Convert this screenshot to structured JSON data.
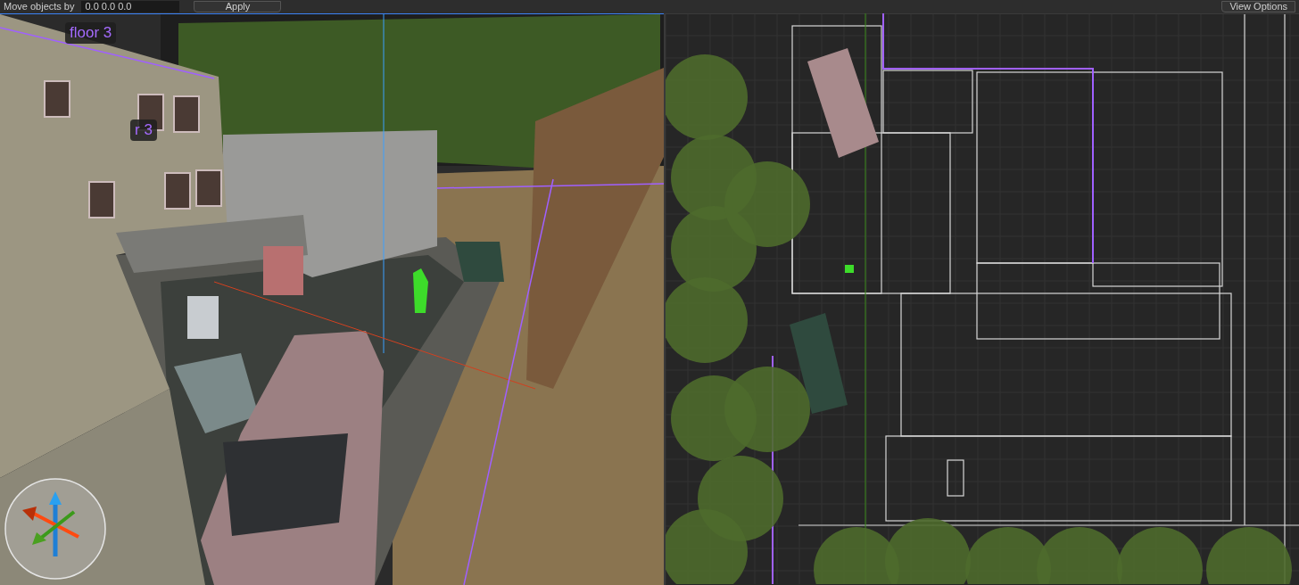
{
  "toolbar": {
    "move_label": "Move objects by",
    "move_value": "0.0 0.0 0.0",
    "apply_button": "Apply",
    "view_options_button": "View Options"
  },
  "viewports": [
    {
      "kind": "perspective",
      "active": true,
      "labels": [
        "floor 3",
        "r 3"
      ]
    },
    {
      "kind": "top",
      "active": false
    }
  ]
}
